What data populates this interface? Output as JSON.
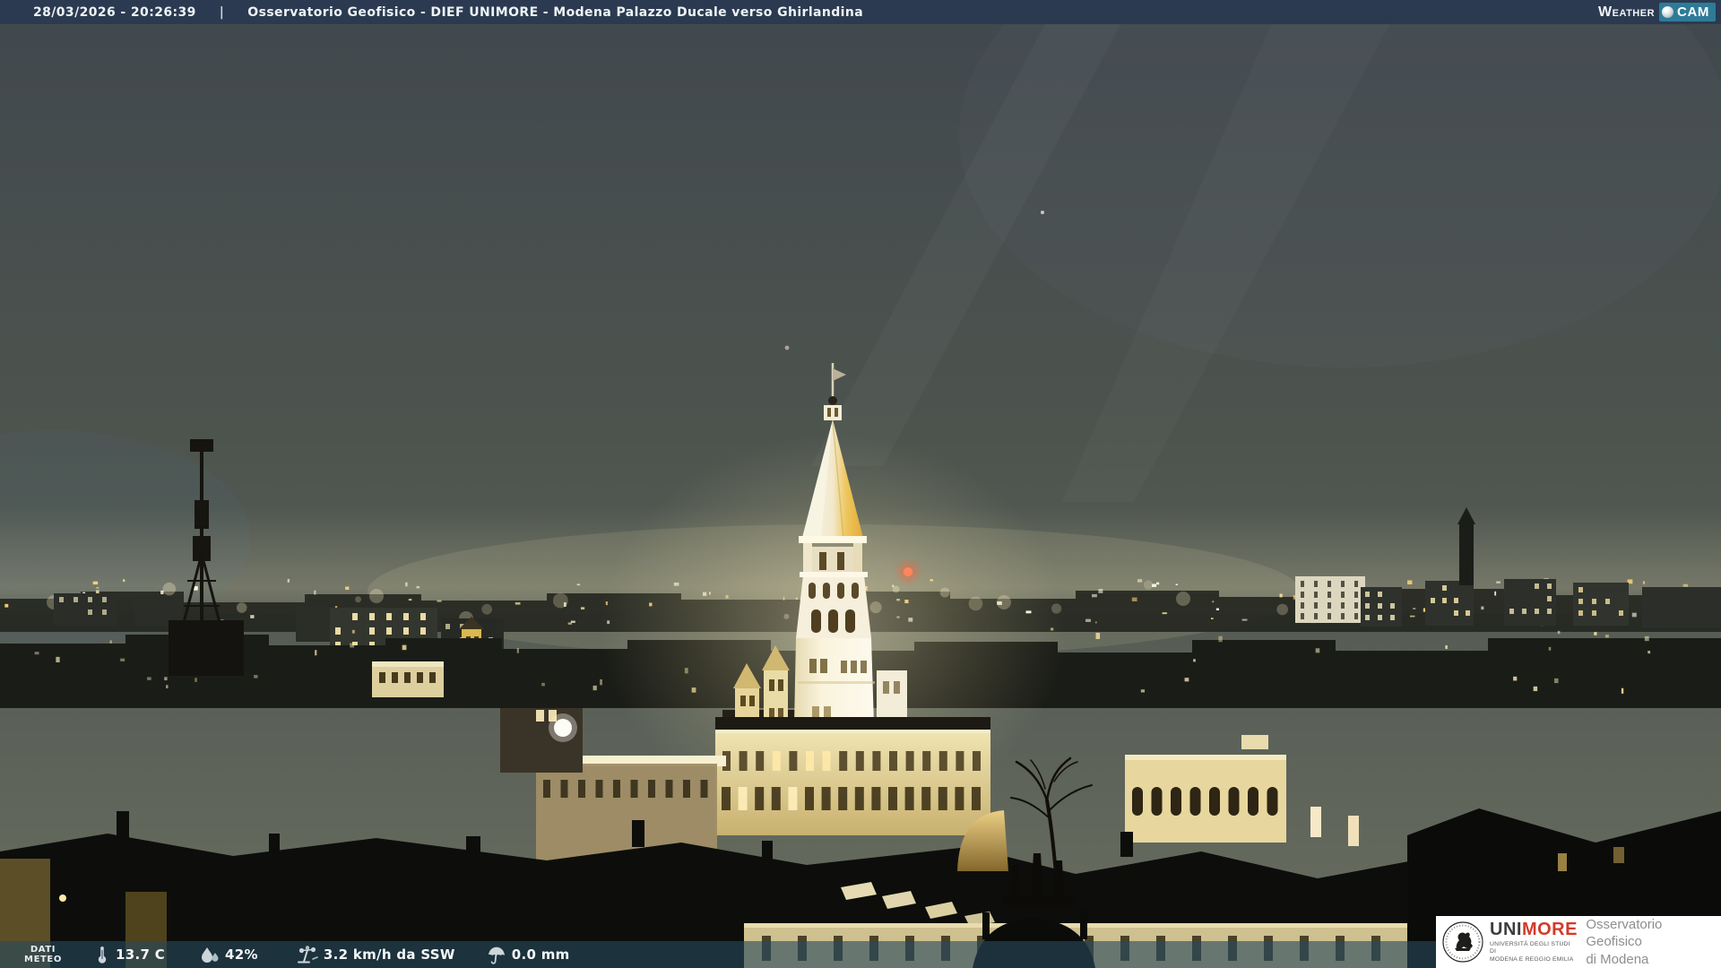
{
  "header": {
    "datetime": "28/03/2026 - 20:26:39",
    "divider": "|",
    "title": "Osservatorio Geofisico - DIEF UNIMORE - Modena Palazzo Ducale verso Ghirlandina",
    "brand": {
      "weather": "Weather",
      "cam": "CAM"
    }
  },
  "weather_bar": {
    "label_line1": "DATI",
    "label_line2": "METEO",
    "temperature": "13.7 C",
    "humidity": "42%",
    "wind": "3.2 km/h da SSW",
    "precipitation": "0.0 mm",
    "icons": [
      "thermometer-icon",
      "humidity-icon",
      "wind-anemometer-icon",
      "umbrella-icon"
    ]
  },
  "footer_logo": {
    "acronym_uni": "UNI",
    "acronym_more": "MORE",
    "university_line1": "UNIVERSITÀ DEGLI STUDI DI",
    "university_line2": "MODENA E REGGIO EMILIA",
    "org_line1": "Osservatorio Geofisico",
    "org_line2": "di Modena"
  },
  "colors": {
    "top_bar": "#2b3a50",
    "bottom_bar": "rgba(38,72,92,0.62)",
    "weathercam_teal": "#2e7b98",
    "unimore_red": "#d23b2a"
  }
}
